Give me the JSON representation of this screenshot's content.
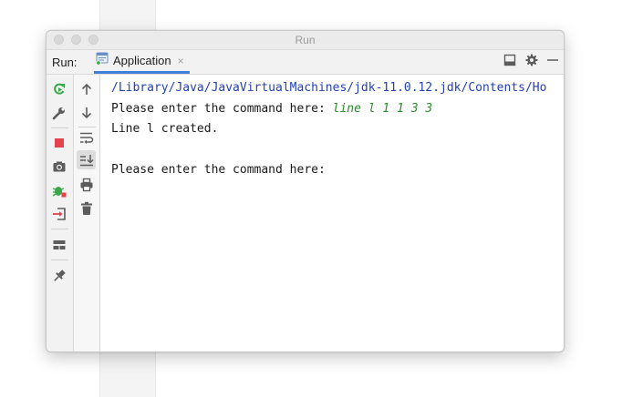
{
  "window": {
    "title": "Run"
  },
  "toolbar": {
    "run_label": "Run:",
    "tab_label": "Application",
    "tab_close": "×"
  },
  "console": {
    "path": "/Library/Java/JavaVirtualMachines/jdk-11.0.12.jdk/Contents/Ho",
    "prompt1": "Please enter the command here: ",
    "input1": "line l 1 1 3 3",
    "output1": "Line l created.",
    "prompt2": "Please enter the command here:"
  },
  "colors": {
    "accent": "#3f7fd7",
    "stop": "#e2434d",
    "rerun": "#3aa84a",
    "path": "#2340b6",
    "user_input": "#2c8a2c"
  },
  "icons": {
    "tab": "application-icon",
    "layout": "layout-icon",
    "settings": "gear-icon",
    "minimize": "minimize-icon",
    "rerun": "rerun-icon",
    "modify": "wrench-icon",
    "stop": "stop-icon",
    "dump": "camera-icon",
    "debug": "debug-icon",
    "exit": "exit-icon",
    "restore": "restore-layout-icon",
    "pin": "pin-icon",
    "up": "arrow-up-icon",
    "down": "arrow-down-icon",
    "softwrap": "soft-wrap-icon",
    "scroll_end": "scroll-to-end-icon",
    "print": "print-icon",
    "clear": "trash-icon"
  }
}
